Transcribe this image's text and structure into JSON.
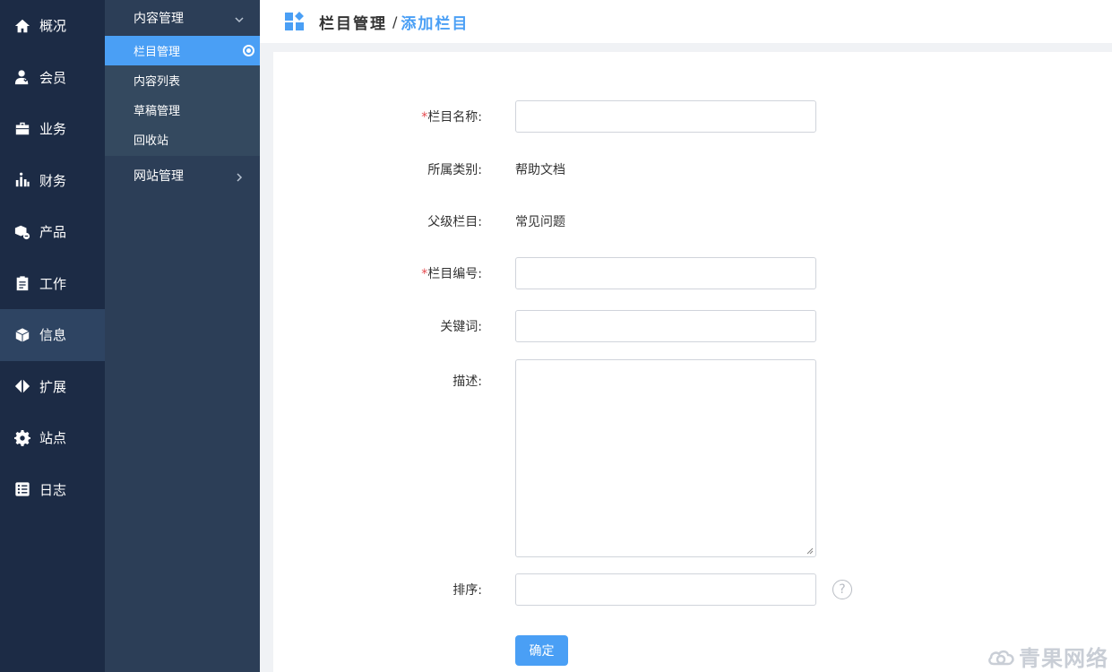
{
  "primary_nav": [
    {
      "label": "概况",
      "icon": "home-icon"
    },
    {
      "label": "会员",
      "icon": "user-icon"
    },
    {
      "label": "业务",
      "icon": "briefcase-icon"
    },
    {
      "label": "财务",
      "icon": "finance-chart-icon"
    },
    {
      "label": "产品",
      "icon": "product-box-icon"
    },
    {
      "label": "工作",
      "icon": "clipboard-icon"
    },
    {
      "label": "信息",
      "icon": "cube-icon",
      "active": true
    },
    {
      "label": "扩展",
      "icon": "expand-arrows-icon"
    },
    {
      "label": "站点",
      "icon": "gear-icon"
    },
    {
      "label": "日志",
      "icon": "log-list-icon"
    }
  ],
  "secondary_nav": {
    "group1": {
      "title": "内容管理",
      "items": [
        {
          "label": "栏目管理",
          "active": true
        },
        {
          "label": "内容列表"
        },
        {
          "label": "草稿管理"
        },
        {
          "label": "回收站"
        }
      ]
    },
    "group2": {
      "title": "网站管理"
    }
  },
  "header": {
    "breadcrumb_main": "栏目管理",
    "separator": "/",
    "breadcrumb_sub": "添加栏目"
  },
  "form": {
    "required_mark": "*",
    "name_label": "栏目名称:",
    "name_value": "",
    "category_label": "所属类别:",
    "category_value": "帮助文档",
    "parent_label": "父级栏目:",
    "parent_value": "常见问题",
    "code_label": "栏目编号:",
    "code_value": "",
    "keywords_label": "关键词:",
    "keywords_value": "",
    "desc_label": "描述:",
    "desc_value": "",
    "order_label": "排序:",
    "order_value": "",
    "help_glyph": "?",
    "submit_label": "确定"
  },
  "watermark": "青果网络",
  "colors": {
    "primary_sidebar": "#1c2b45",
    "secondary_sidebar": "#2c3e57",
    "accent": "#4a9ff5",
    "required": "#e5484d"
  }
}
